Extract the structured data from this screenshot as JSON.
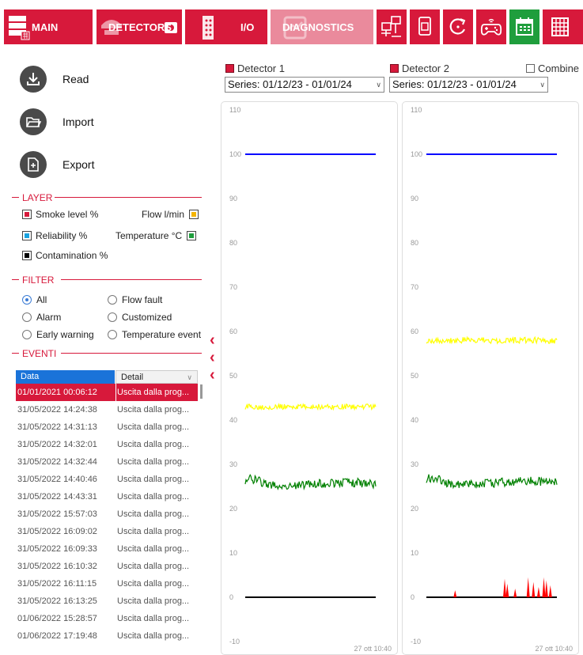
{
  "toolbar": {
    "main_label": "MAIN",
    "detectors_label": "DETECTORS",
    "io_label": "I/O",
    "diagnostics_label": "DIAGNOSTICS",
    "icons": [
      "network-icon",
      "sim-card-icon",
      "refresh-icon",
      "gamepad-icon",
      "calendar-icon",
      "grid-icon"
    ],
    "accent": "#d7193b",
    "active_green": "#1f9e3d"
  },
  "actions": {
    "read": "Read",
    "import": "Import",
    "export": "Export"
  },
  "layer": {
    "title": "LAYER",
    "smoke": "Smoke level %",
    "flow": "Flow l/min",
    "reliability": "Reliability %",
    "temperature": "Temperature °C",
    "contamination": "Contamination %",
    "colors": {
      "smoke": "#d7193b",
      "flow": "#f5b400",
      "reliability": "#1aa3e0",
      "temperature": "#1f9e3d",
      "contamination": "#000000"
    }
  },
  "filter": {
    "title": "FILTER",
    "all": "All",
    "flow_fault": "Flow fault",
    "alarm": "Alarm",
    "customized": "Customized",
    "early_warning": "Early warning",
    "temperature_event": "Temperature event",
    "selected": "All"
  },
  "events": {
    "title": "EVENTI",
    "col_data": "Data",
    "col_detail": "Detail",
    "rows": [
      {
        "date": "01/01/2021 00:06:12",
        "detail": "Uscita dalla prog...",
        "selected": true
      },
      {
        "date": "31/05/2022 14:24:38",
        "detail": "Uscita dalla prog..."
      },
      {
        "date": "31/05/2022 14:31:13",
        "detail": "Uscita dalla prog..."
      },
      {
        "date": "31/05/2022 14:32:01",
        "detail": "Uscita dalla prog..."
      },
      {
        "date": "31/05/2022 14:32:44",
        "detail": "Uscita dalla prog..."
      },
      {
        "date": "31/05/2022 14:40:46",
        "detail": "Uscita dalla prog..."
      },
      {
        "date": "31/05/2022 14:43:31",
        "detail": "Uscita dalla prog..."
      },
      {
        "date": "31/05/2022 15:57:03",
        "detail": "Uscita dalla prog..."
      },
      {
        "date": "31/05/2022 16:09:02",
        "detail": "Uscita dalla prog..."
      },
      {
        "date": "31/05/2022 16:09:33",
        "detail": "Uscita dalla prog..."
      },
      {
        "date": "31/05/2022 16:10:32",
        "detail": "Uscita dalla prog..."
      },
      {
        "date": "31/05/2022 16:11:15",
        "detail": "Uscita dalla prog..."
      },
      {
        "date": "31/05/2022 16:13:25",
        "detail": "Uscita dalla prog..."
      },
      {
        "date": "01/06/2022 15:28:57",
        "detail": "Uscita dalla prog..."
      },
      {
        "date": "01/06/2022 17:19:48",
        "detail": "Uscita dalla prog..."
      }
    ]
  },
  "charts_header": {
    "detector1": "Detector 1",
    "detector2": "Detector 2",
    "combine": "Combine",
    "series1": "Series: 01/12/23 - 01/01/24",
    "series2": "Series: 01/12/23 - 01/01/24"
  },
  "chart_data": [
    {
      "type": "line",
      "panel": "Detector 1",
      "ylim": [
        -10,
        110
      ],
      "yticks": [
        110,
        100,
        90,
        80,
        70,
        60,
        50,
        40,
        30,
        20,
        10,
        0,
        -10
      ],
      "x_tick_label": "27 ott 10:40",
      "grid": false,
      "series": [
        {
          "name": "Reliability %",
          "color": "#0000ff",
          "value": 100
        },
        {
          "name": "Flow l/min",
          "color": "#ffff00",
          "value": 43,
          "noise": 0.6
        },
        {
          "name": "Temperature °C",
          "color": "#008000",
          "value": 25.5,
          "noise": 1.0
        },
        {
          "name": "Contamination %",
          "color": "#000000",
          "value": 0
        }
      ]
    },
    {
      "type": "line",
      "panel": "Detector 2",
      "ylim": [
        -10,
        110
      ],
      "yticks": [
        110,
        100,
        90,
        80,
        70,
        60,
        50,
        40,
        30,
        20,
        10,
        0,
        -10
      ],
      "x_tick_label": "27 ott 10:40",
      "grid": false,
      "series": [
        {
          "name": "Reliability %",
          "color": "#0000ff",
          "value": 100
        },
        {
          "name": "Flow l/min",
          "color": "#ffff00",
          "value": 58,
          "noise": 0.7
        },
        {
          "name": "Temperature °C",
          "color": "#008000",
          "value": 25.8,
          "noise": 1.0
        },
        {
          "name": "Contamination %",
          "color": "#000000",
          "value": 0
        },
        {
          "name": "Smoke level %",
          "color": "#ff0000",
          "spikes": [
            0.22,
            0.6,
            0.62,
            0.68,
            0.78,
            0.82,
            0.86,
            0.9,
            0.92,
            0.95
          ],
          "spike_max": 4.5
        }
      ]
    }
  ]
}
